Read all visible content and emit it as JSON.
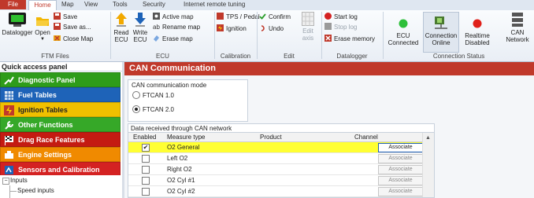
{
  "ribbon_tabs": [
    "File",
    "Home",
    "Map",
    "View",
    "Tools",
    "Security",
    "Internet remote tuning"
  ],
  "ribbon": {
    "ftm_files": {
      "label": "FTM Files",
      "datalogger": "Datalogger",
      "open": "Open",
      "save": "Save",
      "save_as": "Save as...",
      "close_map": "Close Map"
    },
    "ecu": {
      "label": "ECU",
      "read": "Read ECU",
      "write": "Write ECU",
      "active_map": "Active map",
      "rename_map": "Rename map",
      "erase_map": "Erase map"
    },
    "calibration": {
      "label": "Calibration",
      "tps_pedal": "TPS / Pedal",
      "ignition": "Ignition"
    },
    "edit": {
      "label": "Edit",
      "confirm": "Confirm",
      "undo": "Undo",
      "edit_axis": "Edit axis"
    },
    "datalogger_group": {
      "label": "Datalogger",
      "start_log": "Start log",
      "stop_log": "Stop log",
      "erase_memory": "Erase memory"
    },
    "connection": {
      "label": "Connection Status",
      "ecu": "ECU Connected",
      "online": "Connection Online",
      "realtime": "Realtime Disabled",
      "can": "CAN Network",
      "ecu_color": "#2dbf3a",
      "realtime_color": "#e0201a"
    }
  },
  "sidebar": {
    "title": "Quick access panel",
    "items": [
      {
        "label": "Diagnostic Panel",
        "color": "#2e9c1a"
      },
      {
        "label": "Fuel Tables",
        "color": "#1e63b8"
      },
      {
        "label": "Ignition Tables",
        "color": "#f0c000"
      },
      {
        "label": "Other Functions",
        "color": "#36a828"
      },
      {
        "label": "Drag Race Features",
        "color": "#c41b12"
      },
      {
        "label": "Engine Settings",
        "color": "#f08a00"
      },
      {
        "label": "Sensors and Calibration",
        "color": "#d42222"
      }
    ],
    "tree": {
      "inputs": "Inputs",
      "speed_inputs": "Speed inputs"
    }
  },
  "main": {
    "title": "CAN Communication",
    "mode": {
      "title": "CAN communication mode",
      "options": [
        "FTCAN 1.0",
        "FTCAN 2.0"
      ],
      "selected": "FTCAN 2.0"
    },
    "grid": {
      "title": "Data received through CAN network",
      "columns": [
        "Enabled",
        "Measure type",
        "Product",
        "Channel"
      ],
      "rows": [
        {
          "measure": "O2 General",
          "enabled": true,
          "action": "Associate"
        },
        {
          "measure": "Left O2",
          "enabled": false,
          "action": "Associate"
        },
        {
          "measure": "Right O2",
          "enabled": false,
          "action": "Associate"
        },
        {
          "measure": "O2 Cyl #1",
          "enabled": false,
          "action": "Associate"
        },
        {
          "measure": "O2 Cyl #2",
          "enabled": false,
          "action": "Associate"
        }
      ]
    }
  }
}
